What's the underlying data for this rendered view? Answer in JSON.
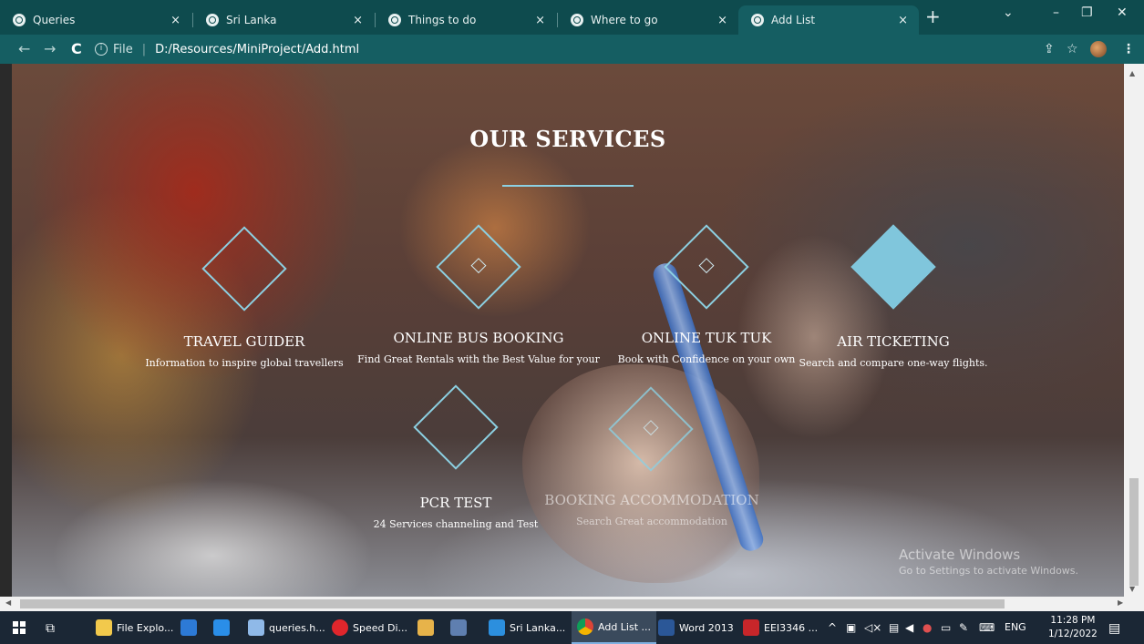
{
  "browser": {
    "tabs": [
      {
        "label": "Queries",
        "active": false
      },
      {
        "label": "Sri Lanka",
        "active": false
      },
      {
        "label": "Things to do",
        "active": false
      },
      {
        "label": "Where to go",
        "active": false
      },
      {
        "label": "Add List",
        "active": true
      }
    ],
    "close_glyph": "×",
    "new_tab_glyph": "+",
    "address": {
      "scheme_label": "File",
      "url": "D:/Resources/MiniProject/Add.html"
    }
  },
  "page": {
    "section_title": "OUR SERVICES",
    "services": [
      {
        "name": "TRAVEL GUIDER",
        "description": "Information to inspire global travellers",
        "icon": "diamond-outline-icon"
      },
      {
        "name": "ONLINE BUS BOOKING",
        "description": "Find Great Rentals with the Best Value for your",
        "icon": "diamond-outline-icon"
      },
      {
        "name": "ONLINE TUK TUK",
        "description": "Book with Confidence on your own",
        "icon": "diamond-outline-icon"
      },
      {
        "name": "AIR TICKETING",
        "description": "Search and compare one-way flights.",
        "icon": "diamond-filled-icon"
      },
      {
        "name": "PCR TEST",
        "description": "24 Services channeling and Test",
        "icon": "diamond-outline-icon"
      },
      {
        "name": "BOOKING ACCOMMODATION",
        "description": "Search Great accommodation",
        "icon": "diamond-outline-icon"
      }
    ],
    "accent_color": "#8cd0e2",
    "watermark": {
      "title": "Activate Windows",
      "subtitle": "Go to Settings to activate Windows."
    }
  },
  "taskbar": {
    "items": [
      {
        "label": "File Explo...",
        "icon": "folder-icon"
      },
      {
        "label": "",
        "icon": "store-icon"
      },
      {
        "label": "",
        "icon": "mail-icon"
      },
      {
        "label": "queries.h...",
        "icon": "notepad-icon"
      },
      {
        "label": "Speed Di...",
        "icon": "opera-icon"
      },
      {
        "label": "",
        "icon": "paint-icon"
      },
      {
        "label": "",
        "icon": "app-icon"
      },
      {
        "label": "Sri Lanka...",
        "icon": "vscode-icon"
      },
      {
        "label": "Add List ...",
        "icon": "chrome-icon",
        "active": true
      },
      {
        "label": "Word 2013",
        "icon": "word-icon"
      },
      {
        "label": "EEI3346 ...",
        "icon": "pdf-icon"
      }
    ],
    "language": "ENG",
    "time": "11:28 PM",
    "date": "1/12/2022"
  }
}
